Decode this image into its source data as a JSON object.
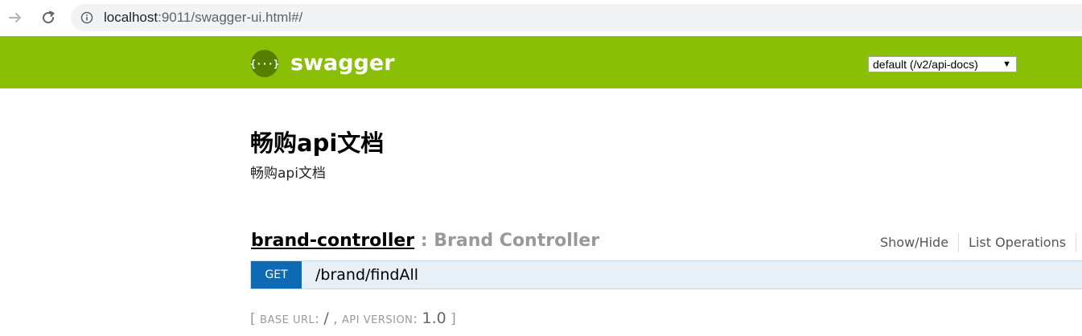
{
  "browser": {
    "url_host": "localhost",
    "url_rest": ":9011/swagger-ui.html#/",
    "icons": [
      "forward-arrow-icon",
      "reload-icon",
      "info-icon"
    ]
  },
  "header": {
    "brand": "swagger",
    "logo_glyph": "{···}",
    "spec_select": {
      "selected": "default (/v2/api-docs)",
      "caret": "▼"
    },
    "colors": {
      "background": "#89bf04",
      "logo_bg": "#547f00"
    }
  },
  "info": {
    "title": "畅购api文档",
    "description": "畅购api文档"
  },
  "controller": {
    "name": "brand-controller",
    "separator": " : ",
    "description": "Brand Controller",
    "options": {
      "show_hide": "Show/Hide",
      "list_operations": "List Operations"
    },
    "endpoints": [
      {
        "method": "GET",
        "path": "/brand/findAll",
        "color": "#0f6ab4"
      }
    ]
  },
  "footer": {
    "open_bracket": "[ ",
    "base_url_label": "base url",
    "base_url_sep": ": ",
    "base_url_value": "/",
    "comma": " , ",
    "api_version_label": "api version",
    "api_version_sep": ": ",
    "api_version_value": "1.0",
    "close_bracket": " ]"
  }
}
